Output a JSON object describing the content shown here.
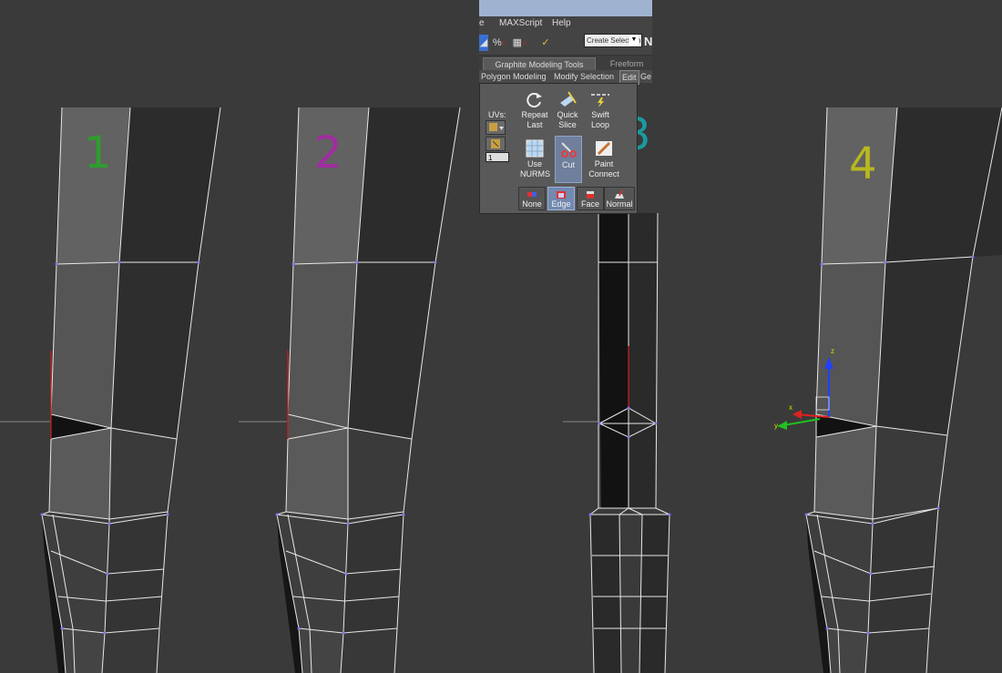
{
  "menu": {
    "items": [
      "e",
      "MAXScript",
      "Help"
    ]
  },
  "toolbar": {
    "selection_set": "Create Selection Se",
    "icons": [
      "select-icon",
      "percent-snap-icon",
      "spinner-snap-icon",
      "edit-named-selection-icon"
    ]
  },
  "ribbon": {
    "tabs": [
      "Graphite Modeling Tools",
      "Freeform"
    ],
    "subtabs": [
      "Polygon Modeling",
      "Modify Selection",
      "Edit",
      "Ge"
    ],
    "uvs_label": "UVs:",
    "spinner_value": "1",
    "tools": [
      {
        "label1": "Repeat",
        "label2": "Last",
        "icon": "repeat-icon"
      },
      {
        "label1": "Quick",
        "label2": "Slice",
        "icon": "quick-slice-icon"
      },
      {
        "label1": "Swift",
        "label2": "Loop",
        "icon": "swift-loop-icon"
      },
      {
        "label1": "Use",
        "label2": "NURMS",
        "icon": "nurms-grid-icon"
      },
      {
        "label1": "Cut",
        "label2": "",
        "icon": "cut-icon"
      },
      {
        "label1": "Paint",
        "label2": "Connect",
        "icon": "paint-connect-icon"
      }
    ],
    "selection_modes": [
      "None",
      "Edge",
      "Face",
      "Normal"
    ],
    "active_tool": "Cut",
    "active_mode": "Edge"
  },
  "annotations": [
    {
      "text": "1",
      "color": "#2e9d2e"
    },
    {
      "text": "2",
      "color": "#a22ca2"
    },
    {
      "text": "3",
      "color": "#1a9aa0"
    },
    {
      "text": "4",
      "color": "#b8b81e"
    }
  ],
  "axis_labels": {
    "x": "x",
    "y": "y",
    "z": "z"
  },
  "colors": {
    "background": "#3a3a3a",
    "wire": "#e8e8e8",
    "vertex": "#7878ff",
    "selected_edge": "#d02020"
  }
}
